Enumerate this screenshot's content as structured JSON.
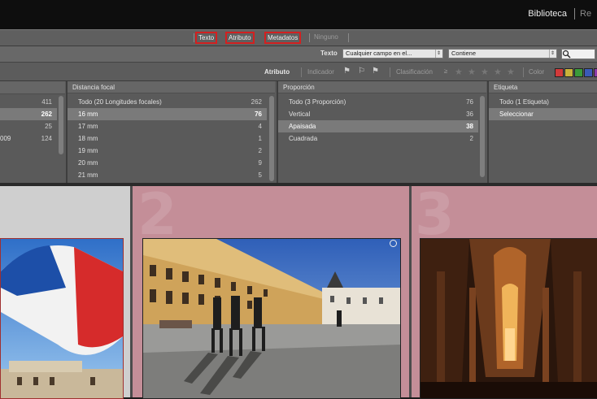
{
  "topbar": {
    "module_active": "Biblioteca",
    "module_next": "Re"
  },
  "filter_tabs": [
    {
      "label": "Texto",
      "active": true
    },
    {
      "label": "Atributo",
      "active": true
    },
    {
      "label": "Metadatos",
      "active": true
    },
    {
      "label": "Ninguno",
      "active": false
    }
  ],
  "text_filter": {
    "label": "Texto",
    "field": "Cualquier campo en el...",
    "rule": "Contiene",
    "search_value": ""
  },
  "attribute_filter": {
    "label": "Atributo",
    "flag_label": "Indicador",
    "rating_label": "Clasificación",
    "rating_operator": "≥",
    "rating_stars": 0,
    "color_label": "Color",
    "colors": [
      "#d23a3a",
      "#c9b23a",
      "#3a9a3a",
      "#3a5ab8",
      "#8a3aa8"
    ]
  },
  "columns": [
    {
      "header": "",
      "rows": [
        {
          "label": "",
          "count": "411",
          "selected": false
        },
        {
          "label": "",
          "count": "262",
          "selected": true
        },
        {
          "label": "",
          "count": "25",
          "selected": false
        },
        {
          "label": "009",
          "count": "124",
          "selected": false
        }
      ]
    },
    {
      "header": "Distancia focal",
      "rows": [
        {
          "label": "Todo (20 Longitudes focales)",
          "count": "262",
          "selected": false
        },
        {
          "label": "16 mm",
          "count": "76",
          "selected": true
        },
        {
          "label": "17 mm",
          "count": "4",
          "selected": false
        },
        {
          "label": "18 mm",
          "count": "1",
          "selected": false
        },
        {
          "label": "19 mm",
          "count": "2",
          "selected": false
        },
        {
          "label": "20 mm",
          "count": "9",
          "selected": false
        },
        {
          "label": "21 mm",
          "count": "5",
          "selected": false
        }
      ]
    },
    {
      "header": "Proporción",
      "rows": [
        {
          "label": "Todo (3 Proporción)",
          "count": "76",
          "selected": false
        },
        {
          "label": "Vertical",
          "count": "36",
          "selected": false
        },
        {
          "label": "Apaisada",
          "count": "38",
          "selected": true
        },
        {
          "label": "Cuadrada",
          "count": "2",
          "selected": false
        }
      ]
    },
    {
      "header": "Etiqueta",
      "rows": [
        {
          "label": "Todo (1 Etiqueta)",
          "count": "",
          "selected": false
        },
        {
          "label": "Seleccionar",
          "count": "",
          "selected": true
        }
      ]
    }
  ],
  "grid": {
    "cells": [
      {
        "number": "",
        "selected": false
      },
      {
        "number": "2",
        "selected": true
      },
      {
        "number": "3",
        "selected": true
      }
    ]
  }
}
